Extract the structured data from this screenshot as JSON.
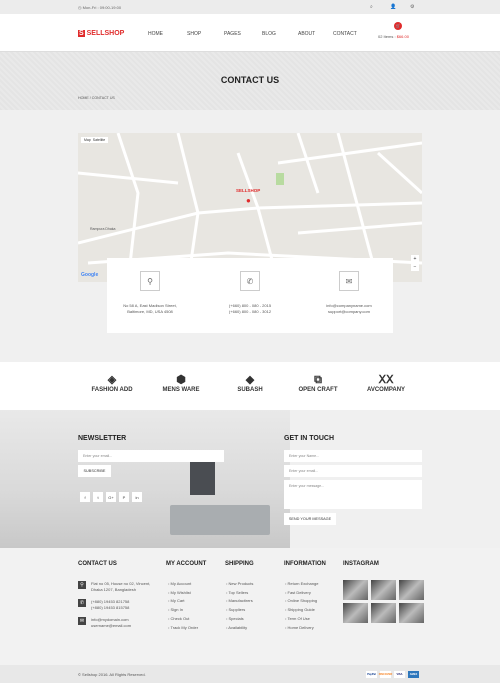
{
  "topbar": {
    "hours": "◷ Mon-Fri : 09:00-19:00",
    "icons": [
      "search-icon",
      "user-icon",
      "gear-icon"
    ]
  },
  "header": {
    "logo": "SELLSHOP",
    "nav": [
      "HOME",
      "SHOP",
      "PAGES",
      "BLOG",
      "ABOUT",
      "CONTACT"
    ],
    "cart_items": "02 Items :",
    "cart_total": "$66.00"
  },
  "banner": {
    "title": "CONTACT US",
    "breadcrumb": [
      "HOME",
      "/",
      "CONTACT US"
    ]
  },
  "map": {
    "tabs": [
      "Map",
      "Satellite"
    ],
    "marker_label": "SELLSHOP",
    "place": "Rampura Dhaka",
    "google": "Google"
  },
  "contact_info": [
    {
      "icon": "map-pin-icon",
      "lines": [
        "No 58 A, East Madison Street,",
        "Baltimore, MD, USA 4508"
      ]
    },
    {
      "icon": "phone-icon",
      "lines": [
        "(+660) 800 - 080 - 2015",
        "(+660) 800 - 080 - 3012"
      ]
    },
    {
      "icon": "envelope-icon",
      "lines": [
        "info@companyname.com",
        "support@company.com"
      ]
    }
  ],
  "brands": [
    {
      "name": "FASHION ADD",
      "glyph": "◈"
    },
    {
      "name": "MENS WARE",
      "glyph": "⬢"
    },
    {
      "name": "SUBASH",
      "glyph": "◆"
    },
    {
      "name": "OPEN CRAFT",
      "glyph": "⧉"
    },
    {
      "name": "AVCOMPANY",
      "glyph": "ⅩⅩ"
    }
  ],
  "newsletter": {
    "title": "NEWSLETTER",
    "placeholder": "Enter your email...",
    "button": "SUBSCRIBE",
    "social": [
      "f",
      "t",
      "G+",
      "P",
      "in"
    ]
  },
  "get_in_touch": {
    "title": "GET IN TOUCH",
    "name_ph": "Enter your Name...",
    "email_ph": "Enter your email...",
    "message_ph": "Enter your message...",
    "button": "SEND YOUR MESSAGE"
  },
  "footer": {
    "contact": {
      "title": "CONTACT US",
      "address": [
        "Flat no 05, House no 02, Vincent,",
        "Dhaka 1207, Bangladesh"
      ],
      "phones": [
        "(+880) 19453 821758",
        "(+880) 19453 815758"
      ],
      "emails": [
        "info@mydomain.com",
        "username@email.com"
      ]
    },
    "my_account": {
      "title": "MY ACCOUNT",
      "items": [
        "My Account",
        "My Wishlist",
        "My Cart",
        "Sign In",
        "Check Out",
        "Track My Order"
      ]
    },
    "shipping": {
      "title": "SHIPPING",
      "items": [
        "New Products",
        "Top Sellers",
        "Manufactirers",
        "Suppliers",
        "Specials",
        "Availability"
      ]
    },
    "information": {
      "title": "INFORMATION",
      "items": [
        "Return Exchange",
        "Fast Delivery",
        "Online Shopping",
        "Shipping Guide",
        "Term Of Use",
        "Home Delivery"
      ]
    },
    "instagram": {
      "title": "INSTAGRAM"
    }
  },
  "bottom": {
    "copyright": "© Sellshop 2016. All Rights Reserved.",
    "payments": [
      "PayPal",
      "DISCOVER",
      "VISA",
      "AMEX"
    ]
  },
  "colors": {
    "accent": "#e02b2b"
  }
}
